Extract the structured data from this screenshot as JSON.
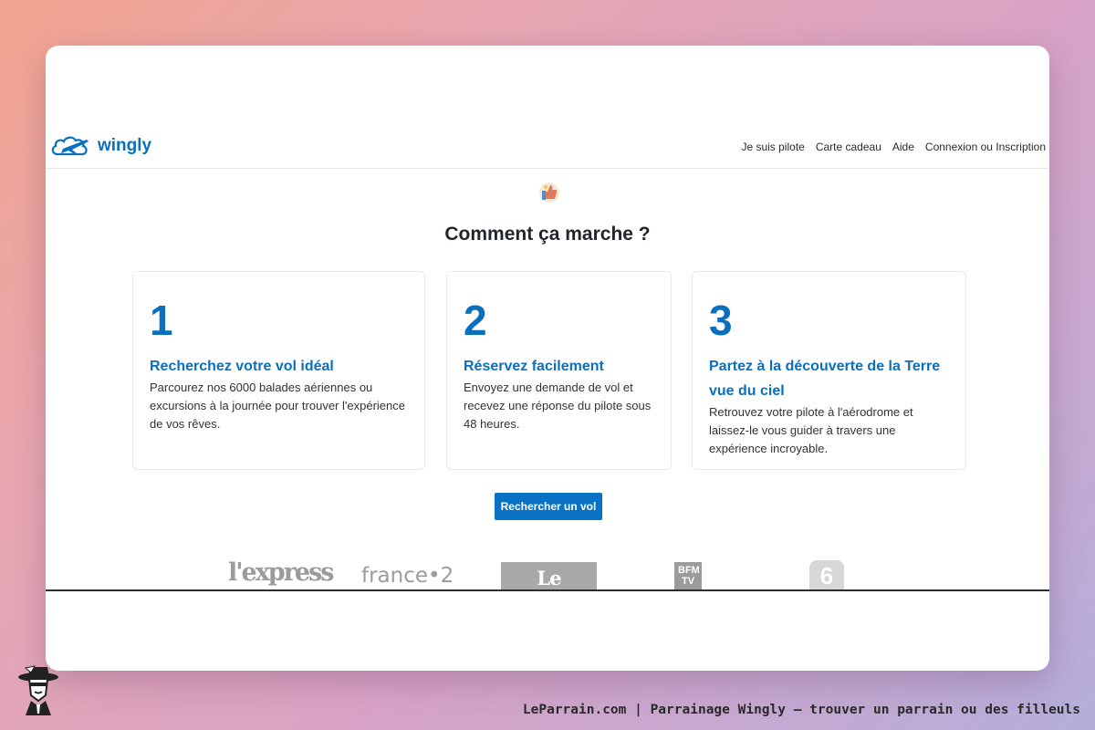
{
  "navbar": {
    "logo_text": "wingly",
    "menu": [
      "Je suis pilote",
      "Carte cadeau",
      "Aide",
      "Connexion ou Inscription"
    ]
  },
  "section": {
    "title": "Comment ça marche ?"
  },
  "steps": [
    {
      "number": "1",
      "heading": "Recherchez votre vol idéal",
      "text": "Parcourez nos 6000 balades aériennes ou excursions à la journée pour trouver l'expérience de vos rêves."
    },
    {
      "number": "2",
      "heading": "Réservez facilement",
      "text": "Envoyez une demande de vol et recevez une réponse du pilote sous 48 heures."
    },
    {
      "number": "3",
      "heading": "Partez à la découverte de la Terre vue du ciel",
      "text": "Retrouvez votre pilote à l'aérodrome et laissez-le vous guider à travers une expérience incroyable."
    }
  ],
  "cta": {
    "label": "Rechercher un vol"
  },
  "press_logos": [
    "l'express",
    "france•2",
    "Le Parisien",
    "BFM TV",
    "6"
  ],
  "footer": {
    "caption": "LeParrain.com | Parrainage Wingly — trouver un parrain ou des filleuls"
  },
  "colors": {
    "brand_blue": "#0a6fbd",
    "button_blue": "#0a72c5"
  }
}
